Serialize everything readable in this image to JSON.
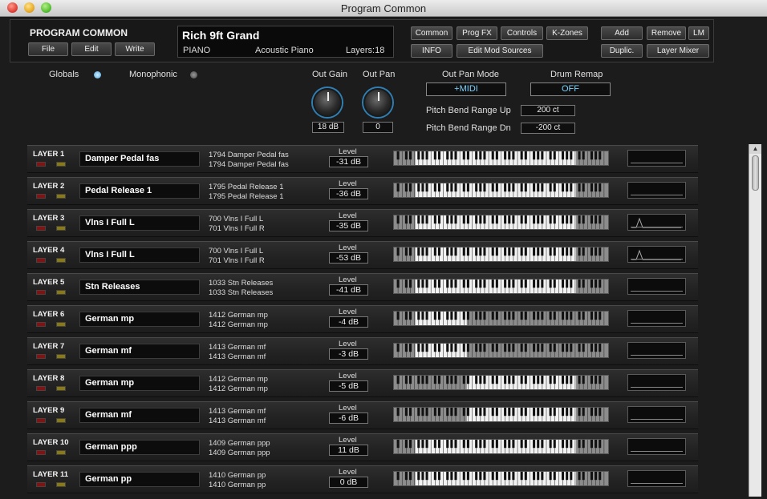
{
  "window": {
    "title": "Program Common"
  },
  "header": {
    "title": "PROGRAM COMMON",
    "buttons": {
      "file": "File",
      "edit": "Edit",
      "write": "Write"
    },
    "display": {
      "program_name": "Rich 9ft Grand",
      "category": "PIANO",
      "subcategory": "Acoustic Piano",
      "layers": "Layers:18"
    },
    "tabs": {
      "common": "Common",
      "prog_fx": "Prog FX",
      "controls": "Controls",
      "kzones": "K-Zones",
      "info": "INFO",
      "edit_mod": "Edit Mod Sources"
    },
    "actions": {
      "add": "Add",
      "remove": "Remove",
      "lm": "LM",
      "duplic": "Duplic.",
      "layer_mixer": "Layer Mixer"
    }
  },
  "globals": {
    "globals_label": "Globals",
    "monophonic_label": "Monophonic",
    "out_gain_label": "Out Gain",
    "out_gain_value": "18 dB",
    "out_pan_label": "Out Pan",
    "out_pan_value": "0",
    "out_pan_mode_label": "Out Pan Mode",
    "out_pan_mode_value": "+MIDI",
    "drum_remap_label": "Drum Remap",
    "drum_remap_value": "OFF",
    "pb_up_label": "Pitch Bend Range Up",
    "pb_up_value": "200 ct",
    "pb_dn_label": "Pitch Bend Range Dn",
    "pb_dn_value": "-200 ct"
  },
  "layers": [
    {
      "label": "LAYER 1",
      "name": "Damper Pedal fas",
      "ks1": "1794 Damper Pedal fas",
      "ks2": "1794 Damper Pedal fas",
      "level_label": "Level",
      "level": "-31 dB",
      "range": [
        0.1,
        0.85
      ],
      "env": "flat"
    },
    {
      "label": "LAYER 2",
      "name": "Pedal Release 1",
      "ks1": "1795 Pedal Release 1",
      "ks2": "1795 Pedal Release 1",
      "level_label": "Level",
      "level": "-36 dB",
      "range": [
        0.1,
        0.85
      ],
      "env": "flat"
    },
    {
      "label": "LAYER 3",
      "name": "Vlns I Full L",
      "ks1": "700 Vlns I Full L",
      "ks2": "701 Vlns I Full R",
      "level_label": "Level",
      "level": "-35 dB",
      "range": [
        0.1,
        0.85
      ],
      "env": "peak"
    },
    {
      "label": "LAYER 4",
      "name": "Vlns I Full L",
      "ks1": "700 Vlns I Full L",
      "ks2": "701 Vlns I Full R",
      "level_label": "Level",
      "level": "-53 dB",
      "range": [
        0.1,
        0.85
      ],
      "env": "peak"
    },
    {
      "label": "LAYER 5",
      "name": "Stn Releases",
      "ks1": "1033 Stn Releases",
      "ks2": "1033 Stn Releases",
      "level_label": "Level",
      "level": "-41 dB",
      "range": [
        0.1,
        0.85
      ],
      "env": "flat"
    },
    {
      "label": "LAYER 6",
      "name": "German mp",
      "ks1": "1412 German mp",
      "ks2": "1412 German mp",
      "level_label": "Level",
      "level": "-4 dB",
      "range": [
        0.1,
        0.34
      ],
      "env": "flat"
    },
    {
      "label": "LAYER 7",
      "name": "German mf",
      "ks1": "1413 German mf",
      "ks2": "1413 German mf",
      "level_label": "Level",
      "level": "-3 dB",
      "range": [
        0.1,
        0.34
      ],
      "env": "flat"
    },
    {
      "label": "LAYER 8",
      "name": "German mp",
      "ks1": "1412 German mp",
      "ks2": "1412 German mp",
      "level_label": "Level",
      "level": "-5 dB",
      "range": [
        0.34,
        0.85
      ],
      "env": "flat"
    },
    {
      "label": "LAYER 9",
      "name": "German mf",
      "ks1": "1413 German mf",
      "ks2": "1413 German mf",
      "level_label": "Level",
      "level": "-6 dB",
      "range": [
        0.34,
        0.85
      ],
      "env": "flat"
    },
    {
      "label": "LAYER 10",
      "name": "German ppp",
      "ks1": "1409 German ppp",
      "ks2": "1409 German ppp",
      "level_label": "Level",
      "level": "11 dB",
      "range": [
        0.1,
        0.85
      ],
      "env": "flat"
    },
    {
      "label": "LAYER 11",
      "name": "German pp",
      "ks1": "1410 German pp",
      "ks2": "1410 German pp",
      "level_label": "Level",
      "level": "0 dB",
      "range": [
        0.1,
        0.85
      ],
      "env": "flat"
    }
  ]
}
